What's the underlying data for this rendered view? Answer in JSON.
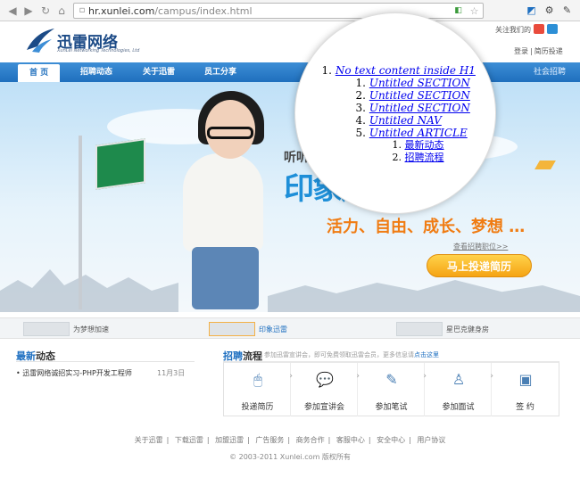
{
  "browser": {
    "url_host": "hr.xunlei.com",
    "url_path": "/campus/index.html"
  },
  "header": {
    "logo_cn": "迅雷网络",
    "logo_en": "XunLei Networking Technologies, Ltd",
    "follow_label": "关注我们的",
    "login": "登录",
    "resume": "简历投递"
  },
  "nav": {
    "items": [
      "首 页",
      "招聘动态",
      "关于迅雷",
      "员工分享"
    ],
    "social": "社会招聘"
  },
  "banner": {
    "slogan_top": "听听",
    "slogan_main": "印象迅雷",
    "slogan_values": "活力、自由、成长、梦想 …",
    "view_link": "查看招聘职位>>",
    "apply_button": "马上投递简历"
  },
  "thumbs": [
    "为梦想加速",
    "印象迅雷",
    "星巴克健身房"
  ],
  "news": {
    "title_hl": "最新",
    "title_rest": "动态",
    "items": [
      {
        "text": "迅雷网络诚招实习-PHP开发工程师",
        "date": "11月3日"
      }
    ]
  },
  "process": {
    "title_hl": "招聘",
    "title_rest": "流程",
    "subtitle": "参加迅雷宣讲会，即可免费领取迅雷会员，更多信息请",
    "subtitle_link": "点击这里",
    "steps": [
      "投递简历",
      "参加宣讲会",
      "参加笔试",
      "参加面试",
      "签 约"
    ]
  },
  "footer": {
    "links": [
      "关于迅雷",
      "下载迅雷",
      "加盟迅雷",
      "广告服务",
      "商务合作",
      "客服中心",
      "安全中心",
      "用户协议"
    ],
    "copyright": "© 2003-2011 Xunlei.com 版权所有"
  },
  "outline": {
    "h1": "No text content inside H1",
    "sections": [
      "Untitled SECTION",
      "Untitled SECTION",
      "Untitled SECTION",
      "Untitled NAV",
      "Untitled ARTICLE"
    ],
    "article_items": [
      "最新动态",
      "招聘流程"
    ]
  },
  "colors": {
    "nav_blue": "#1f6fbd",
    "link_blue": "#1e6fc0",
    "accent_orange": "#f5a414"
  }
}
